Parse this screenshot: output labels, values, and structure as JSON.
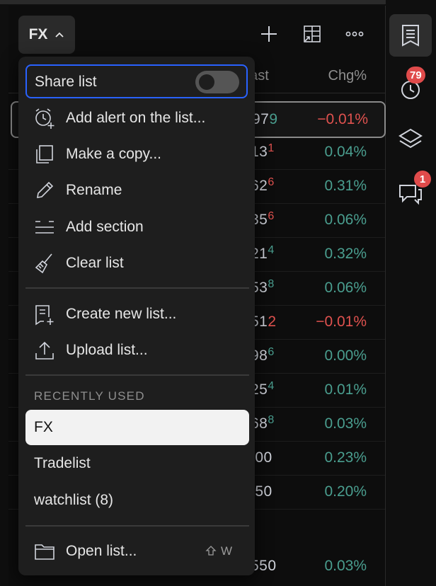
{
  "toolbar": {
    "list_name": "FX"
  },
  "columns": {
    "last": "Last",
    "chg": "Chg%"
  },
  "rows": [
    {
      "last_visible": "97",
      "last_tail": "9",
      "tail_class": "pos",
      "chg": "−0.01%",
      "chg_class": "neg"
    },
    {
      "last_visible": "13",
      "last_tail": "1",
      "tail_class": "neg",
      "chg": "0.04%",
      "chg_class": "pos"
    },
    {
      "last_visible": "62",
      "last_tail": "6",
      "tail_class": "neg",
      "chg": "0.31%",
      "chg_class": "pos"
    },
    {
      "last_visible": "35",
      "last_tail": "6",
      "tail_class": "neg",
      "chg": "0.06%",
      "chg_class": "pos"
    },
    {
      "last_visible": "21",
      "last_tail": "4",
      "tail_class": "pos",
      "chg": "0.32%",
      "chg_class": "pos"
    },
    {
      "last_visible": "53",
      "last_tail": "8",
      "tail_class": "pos",
      "chg": "0.06%",
      "chg_class": "pos"
    },
    {
      "last_visible": "51",
      "last_tail": "2",
      "tail_class": "neg",
      "chg": "−0.01%",
      "chg_class": "neg"
    },
    {
      "last_visible": "98",
      "last_tail": "6",
      "tail_class": "pos",
      "chg": "0.00%",
      "chg_class": "zero"
    },
    {
      "last_visible": "25",
      "last_tail": "4",
      "tail_class": "pos",
      "chg": "0.01%",
      "chg_class": "pos"
    },
    {
      "last_visible": "68",
      "last_tail": "8",
      "tail_class": "pos",
      "chg": "0.03%",
      "chg_class": "pos"
    },
    {
      "last_visible": ".00",
      "last_tail": "",
      "tail_class": "pos",
      "chg": "0.23%",
      "chg_class": "pos"
    },
    {
      "last_visible": ".50",
      "last_tail": "",
      "tail_class": "pos",
      "chg": "0.20%",
      "chg_class": "pos"
    }
  ],
  "extra_row": {
    "last_visible": "550",
    "chg": "0.03%"
  },
  "sidebar": {
    "alerts_badge": "79",
    "chat_badge": "1"
  },
  "menu": {
    "share_label": "Share list",
    "share_enabled": false,
    "items": [
      {
        "label": "Add alert on the list...",
        "icon": "alarm-add-icon"
      },
      {
        "label": "Make a copy...",
        "icon": "copy-icon"
      },
      {
        "label": "Rename",
        "icon": "pencil-icon"
      },
      {
        "label": "Add section",
        "icon": "section-icon"
      },
      {
        "label": "Clear list",
        "icon": "broom-icon"
      }
    ],
    "items2": [
      {
        "label": "Create new list...",
        "icon": "new-list-icon"
      },
      {
        "label": "Upload list...",
        "icon": "upload-icon"
      }
    ],
    "recently_used_label": "RECENTLY USED",
    "recent": [
      {
        "label": "FX",
        "current": true
      },
      {
        "label": "Tradelist",
        "current": false
      },
      {
        "label": "watchlist (8)",
        "current": false
      }
    ],
    "open_label": "Open list...",
    "open_shortcut": "W"
  },
  "colors": {
    "accent": "#2962ff",
    "positive": "#4a9e8f",
    "negative": "#e0524f",
    "badge": "#e04b4b"
  }
}
